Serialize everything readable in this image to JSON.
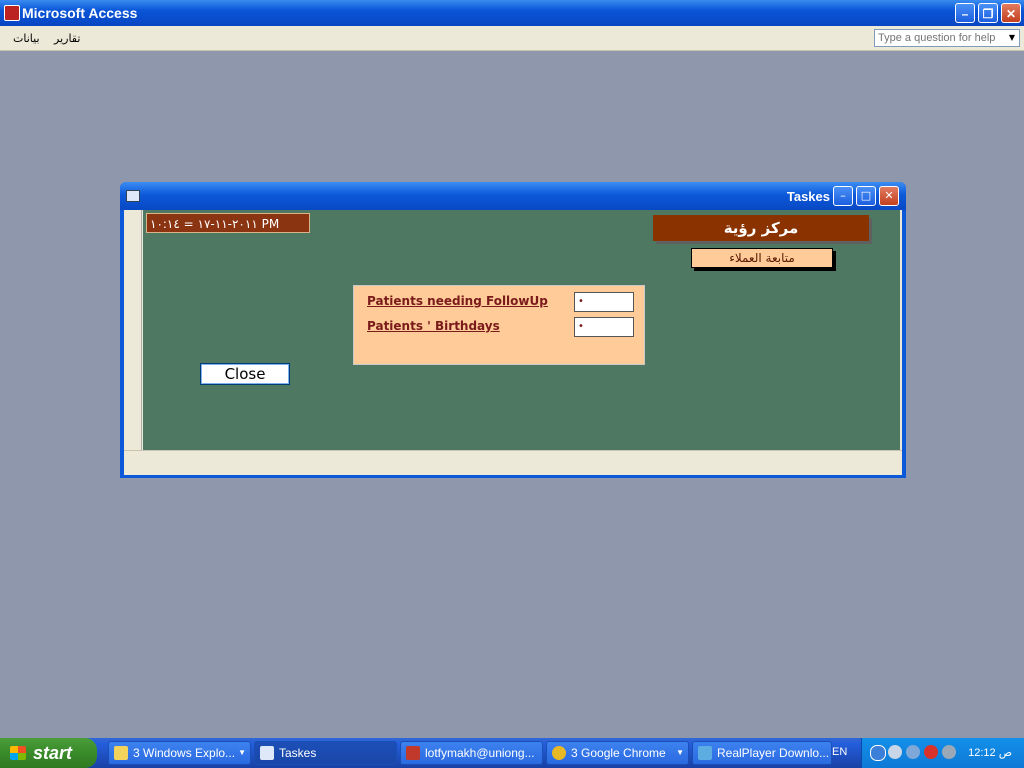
{
  "app": {
    "title": "Microsoft Access"
  },
  "menu": {
    "items": [
      "تقارير",
      "بيانات"
    ]
  },
  "help": {
    "placeholder": "Type a question for help"
  },
  "window": {
    "title": "Taskes"
  },
  "form": {
    "datetime": "٢٠١١-١١-١٧  =  ١٠:١٤ PM",
    "center_name": "مركز رؤية",
    "followup_button": "متابعة العملاء",
    "tasks": [
      {
        "label": "Patients needing FollowUp",
        "value": "•"
      },
      {
        "label": "Patients ' Birthdays",
        "value": "•"
      }
    ],
    "close_button": "Close"
  },
  "taskbar": {
    "start_label": "start",
    "buttons": [
      {
        "label": "3 Windows Explo...",
        "icon": "folder-icon",
        "color": "#f3d35b"
      },
      {
        "label": "Taskes",
        "icon": "form-icon",
        "color": "#dfe8f8",
        "active": true
      },
      {
        "label": "lotfymakh@uniong...",
        "icon": "filezilla-icon",
        "color": "#c0392b"
      },
      {
        "label": "3 Google Chrome",
        "icon": "chrome-icon",
        "color": "#e8b825"
      },
      {
        "label": "RealPlayer Downlo...",
        "icon": "download-icon",
        "color": "#5dade2"
      }
    ],
    "language": "EN",
    "clock": "12:12 ص"
  },
  "colors": {
    "detail_bg": "#4f7862",
    "panel_bg": "#ffcc99",
    "accent_brown": "#8b3300"
  }
}
